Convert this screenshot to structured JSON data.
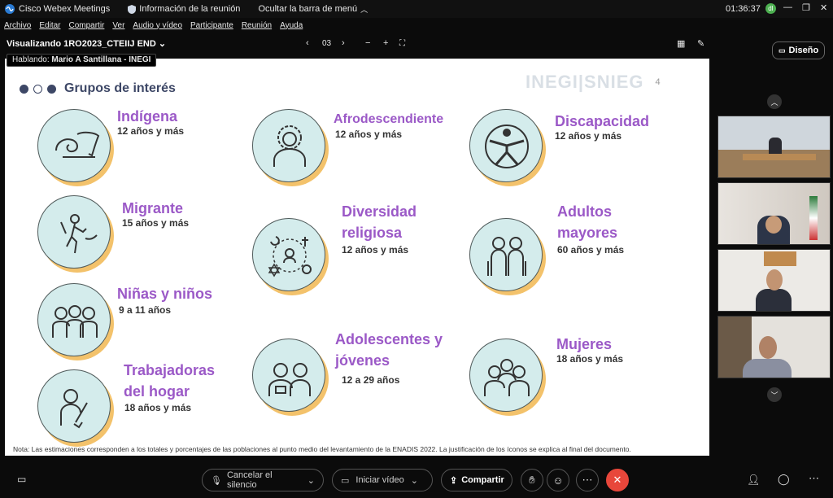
{
  "titlebar": {
    "app_name": "Cisco Webex Meetings",
    "meeting_info": "Información de la reunión",
    "hide_menu": "Ocultar la barra de menú",
    "clock": "01:36:37",
    "status_badge": "dl"
  },
  "menu": {
    "items": [
      "Archivo",
      "Editar",
      "Compartir",
      "Ver",
      "Audio y vídeo",
      "Participante",
      "Reunión",
      "Ayuda"
    ]
  },
  "viewbar": {
    "viewing": "Visualizando 1RO2023_CTEIIJ END",
    "page": "03",
    "design_label": "Diseño"
  },
  "speaking": {
    "label": "Hablando:",
    "name": "Mario A Santillana - INEGI"
  },
  "slide": {
    "heading": "Grupos de interés",
    "logo": "INEGI|SNIEG",
    "page_number": "4",
    "groups": [
      {
        "title": "Indígena",
        "age": "12 años y más"
      },
      {
        "title": "Afrodescendiente",
        "age": "12 años y más"
      },
      {
        "title": "Discapacidad",
        "age": "12 años y más"
      },
      {
        "title": "Migrante",
        "age": "15 años y más"
      },
      {
        "title": "Diversidad religiosa",
        "age": "12 años y más"
      },
      {
        "title": "Adultos mayores",
        "age": "60 años y más"
      },
      {
        "title": "Niñas y niños",
        "age": "9 a 11 años"
      },
      {
        "title": "Adolescentes y jóvenes",
        "age": "12 a 29 años"
      },
      {
        "title": "Mujeres",
        "age": "18 años y más"
      },
      {
        "title": "Trabajadoras del hogar",
        "age": "18 años y más"
      }
    ],
    "note": "Nota: Las estimaciones corresponden a los totales y porcentajes de las poblaciones al punto medio del levantamiento de la ENADIS 2022.  La justificación de los íconos se explica al final del documento."
  },
  "bottombar": {
    "mute_label": "Cancelar el silencio",
    "video_label": "Iniciar vídeo",
    "share_label": "Compartir"
  },
  "colors": {
    "accent_purple": "#9b59c7",
    "circle_fill": "#d4ecec",
    "shadow_yellow": "#f3c26b",
    "end_red": "#e8473b"
  }
}
